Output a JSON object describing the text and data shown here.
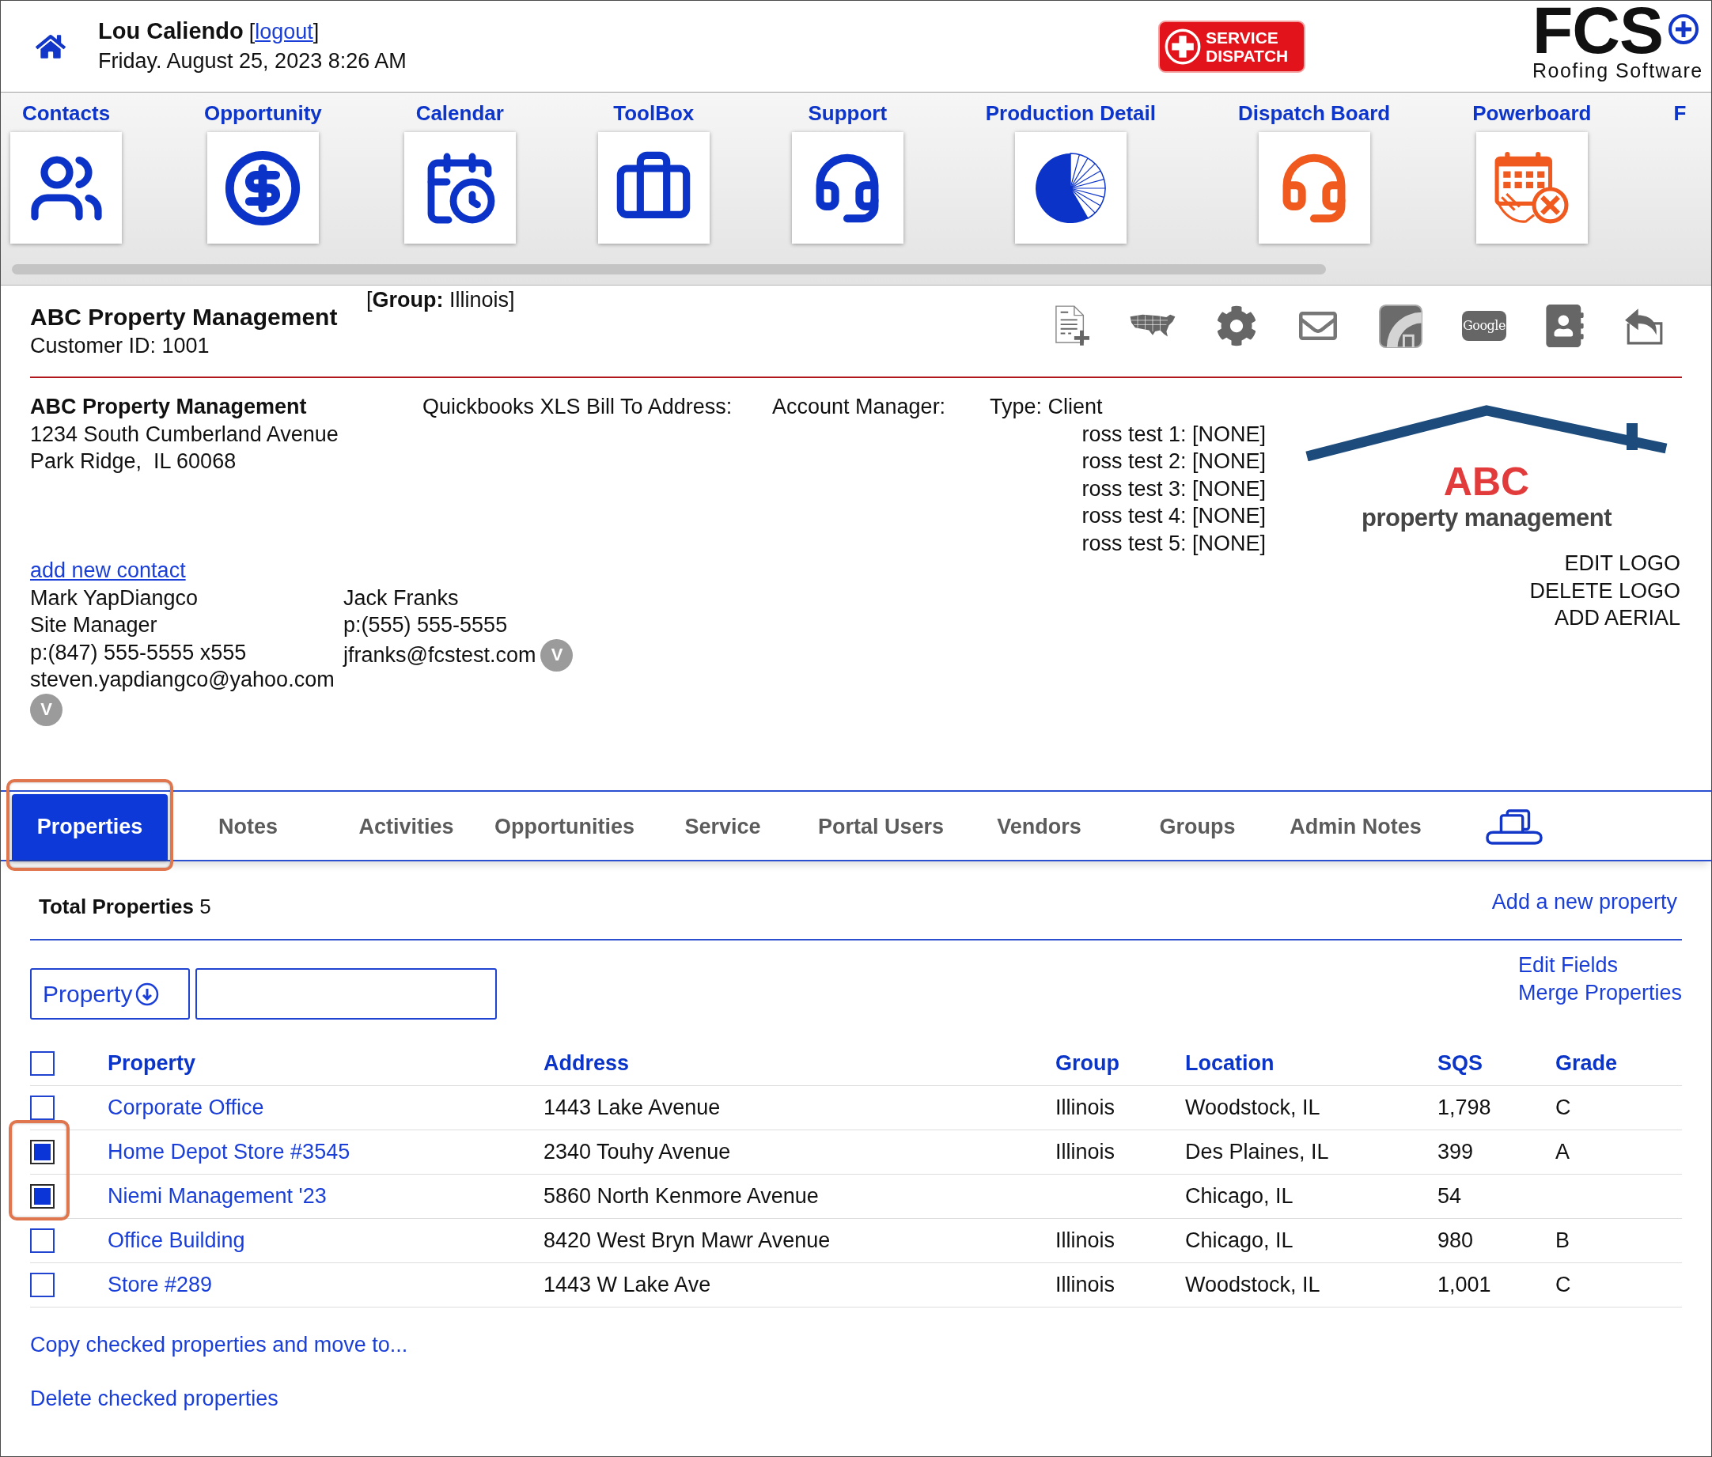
{
  "header": {
    "user_name": "Lou Caliendo",
    "logout": {
      "before": "[",
      "label": "logout",
      "after": "]"
    },
    "datetime": "Friday. August 25, 2023 8:26 AM"
  },
  "service_dispatch": {
    "line_1": "SERVICE",
    "line_2": "DISPATCH"
  },
  "brand": {
    "name": "FCS",
    "tagline": "Roofing Software"
  },
  "nav": [
    {
      "label": "Contacts",
      "kind": "people",
      "color": "#0b33c8"
    },
    {
      "label": "Opportunity",
      "kind": "dollar",
      "color": "#0b33c8"
    },
    {
      "label": "Calendar",
      "kind": "calendar",
      "color": "#0b33c8"
    },
    {
      "label": "ToolBox",
      "kind": "briefcase",
      "color": "#0b33c8"
    },
    {
      "label": "Support",
      "kind": "headset",
      "color": "#0b33c8"
    },
    {
      "label": "Production Detail",
      "kind": "pie",
      "color": "#0b33c8"
    },
    {
      "label": "Dispatch Board",
      "kind": "headset",
      "color": "#f05a1e"
    },
    {
      "label": "Powerboard",
      "kind": "planner",
      "color": "#f05a1e"
    },
    {
      "label": "F"
    }
  ],
  "customer": {
    "name": "ABC Property Management",
    "customer_id": "Customer ID: 1001",
    "group": "[**Group:** Illinois]"
  },
  "toolbar": [
    {
      "kind": "new-document"
    },
    {
      "kind": "us-map"
    },
    {
      "kind": "gear"
    },
    {
      "kind": "envelope"
    },
    {
      "kind": "arc-tile"
    },
    {
      "kind": "google",
      "label": "Google"
    },
    {
      "kind": "address-book"
    },
    {
      "kind": "reply"
    }
  ],
  "details": {
    "billing_name": "ABC Property Management",
    "address_lines": [
      "1234 South Cumberland Avenue",
      "Park Ridge,  IL 60068"
    ],
    "quickbooks_label": "Quickbooks XLS Bill To Address:",
    "account_manager_label": "Account Manager:",
    "type": "Type: Client",
    "custom_fields": [
      "ross test 1: [NONE]",
      "ross test 2: [NONE]",
      "ross test 3: [NONE]",
      "ross test 4: [NONE]",
      "ross test 5: [NONE]"
    ]
  },
  "logo": {
    "title": "ABC",
    "subtitle": "property management",
    "actions": [
      "EDIT LOGO",
      "DELETE LOGO",
      "ADD AERIAL"
    ]
  },
  "contacts": {
    "add_link": "add new contact",
    "people": [
      {
        "name": "Mark YapDiangco",
        "title": "Site Manager",
        "phone": "p:(847) 555-5555 x555",
        "email": "steven.yapdiangco@yahoo.com",
        "badge": "V"
      },
      {
        "name": "Jack Franks",
        "phone": "p:(555) 555-5555",
        "email": "jfranks@fcstest.com",
        "badge": "V"
      }
    ]
  },
  "tabs": [
    {
      "label": "Properties",
      "selected": true,
      "highlighted": true
    },
    {
      "label": "Notes",
      "selected": false,
      "highlighted": false
    },
    {
      "label": "Activities",
      "selected": false,
      "highlighted": false
    },
    {
      "label": "Opportunities",
      "selected": false,
      "highlighted": false
    },
    {
      "label": "Service",
      "selected": false,
      "highlighted": false
    },
    {
      "label": "Portal Users",
      "selected": false,
      "highlighted": false
    },
    {
      "label": "Vendors",
      "selected": false,
      "highlighted": false
    },
    {
      "label": "Groups",
      "selected": false,
      "highlighted": false
    },
    {
      "label": "Admin Notes",
      "selected": false,
      "highlighted": false
    }
  ],
  "properties": {
    "total": "**Total Properties** 5",
    "add_link": "Add a new property",
    "filter": {
      "field": "Property"
    },
    "links": [
      "Edit Fields",
      "Merge Properties"
    ],
    "table": {
      "select_all_checked": false,
      "columns": [
        "Property",
        "Address",
        "Group",
        "Location",
        "SQS",
        "Grade"
      ],
      "rows": [
        {
          "checked": false,
          "highlighted": false,
          "property": "Corporate Office",
          "address": "1443 Lake Avenue",
          "group": "Illinois",
          "location": "Woodstock, IL",
          "sqs": "1,798",
          "grade": "C"
        },
        {
          "checked": true,
          "highlighted": true,
          "property": "Home Depot Store #3545",
          "address": "2340 Touhy Avenue",
          "group": "Illinois",
          "location": "Des Plaines, IL",
          "sqs": "399",
          "grade": "A"
        },
        {
          "checked": true,
          "highlighted": true,
          "property": "Niemi Management '23",
          "address": "5860 North Kenmore Avenue",
          "location": "Chicago, IL",
          "sqs": "54"
        },
        {
          "checked": false,
          "highlighted": false,
          "property": "Office Building",
          "address": "8420 West Bryn Mawr Avenue",
          "group": "Illinois",
          "location": "Chicago, IL",
          "sqs": "980",
          "grade": "B"
        },
        {
          "checked": false,
          "highlighted": false,
          "property": "Store #289",
          "address": "1443 W Lake Ave",
          "group": "Illinois",
          "location": "Woodstock, IL",
          "sqs": "1,001",
          "grade": "C"
        }
      ]
    },
    "bulk_actions": [
      "Copy checked properties and move to...",
      "Delete checked properties"
    ]
  }
}
